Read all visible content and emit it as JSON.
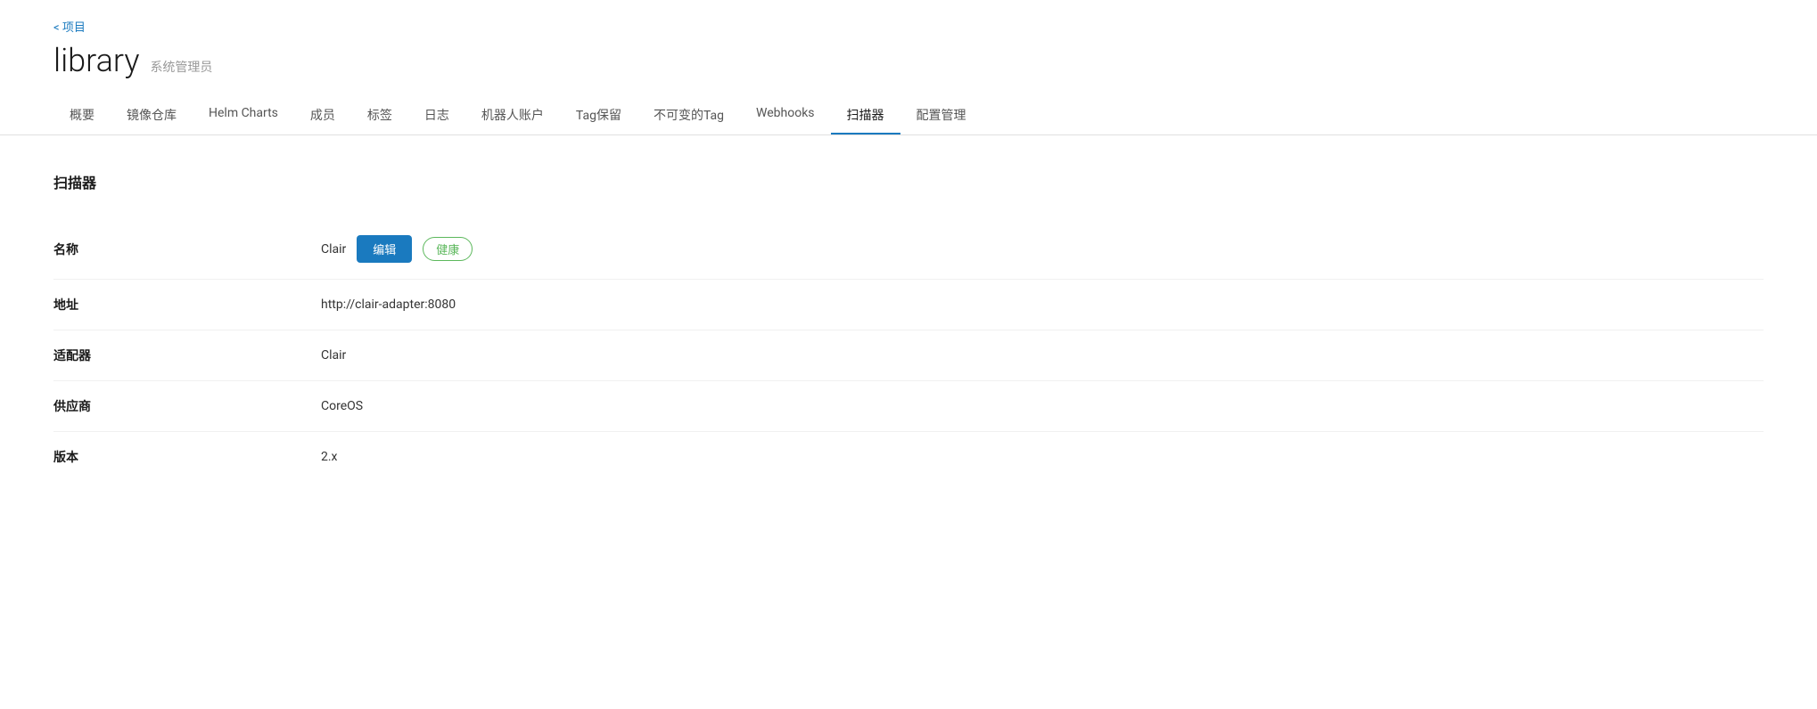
{
  "back_link": "< 项目",
  "project": {
    "name": "library",
    "role": "系统管理员"
  },
  "nav": {
    "tabs": [
      {
        "id": "overview",
        "label": "概要",
        "active": false
      },
      {
        "id": "image-repo",
        "label": "镜像仓库",
        "active": false
      },
      {
        "id": "helm-charts",
        "label": "Helm Charts",
        "active": false
      },
      {
        "id": "members",
        "label": "成员",
        "active": false
      },
      {
        "id": "tags",
        "label": "标签",
        "active": false
      },
      {
        "id": "logs",
        "label": "日志",
        "active": false
      },
      {
        "id": "robot-accounts",
        "label": "机器人账户",
        "active": false
      },
      {
        "id": "tag-retention",
        "label": "Tag保留",
        "active": false
      },
      {
        "id": "immutable-tag",
        "label": "不可变的Tag",
        "active": false
      },
      {
        "id": "webhooks",
        "label": "Webhooks",
        "active": false
      },
      {
        "id": "scanner",
        "label": "扫描器",
        "active": true
      },
      {
        "id": "config",
        "label": "配置管理",
        "active": false
      }
    ]
  },
  "scanner": {
    "section_title": "扫描器",
    "fields": [
      {
        "id": "name",
        "label": "名称",
        "value": "Clair",
        "has_edit_button": true,
        "edit_label": "编辑",
        "has_status": true,
        "status_label": "健康"
      },
      {
        "id": "address",
        "label": "地址",
        "value": "http://clair-adapter:8080",
        "has_edit_button": false,
        "has_status": false
      },
      {
        "id": "adapter",
        "label": "适配器",
        "value": "Clair",
        "has_edit_button": false,
        "has_status": false
      },
      {
        "id": "vendor",
        "label": "供应商",
        "value": "CoreOS",
        "has_edit_button": false,
        "has_status": false
      },
      {
        "id": "version",
        "label": "版本",
        "value": "2.x",
        "has_edit_button": false,
        "has_status": false
      }
    ]
  }
}
